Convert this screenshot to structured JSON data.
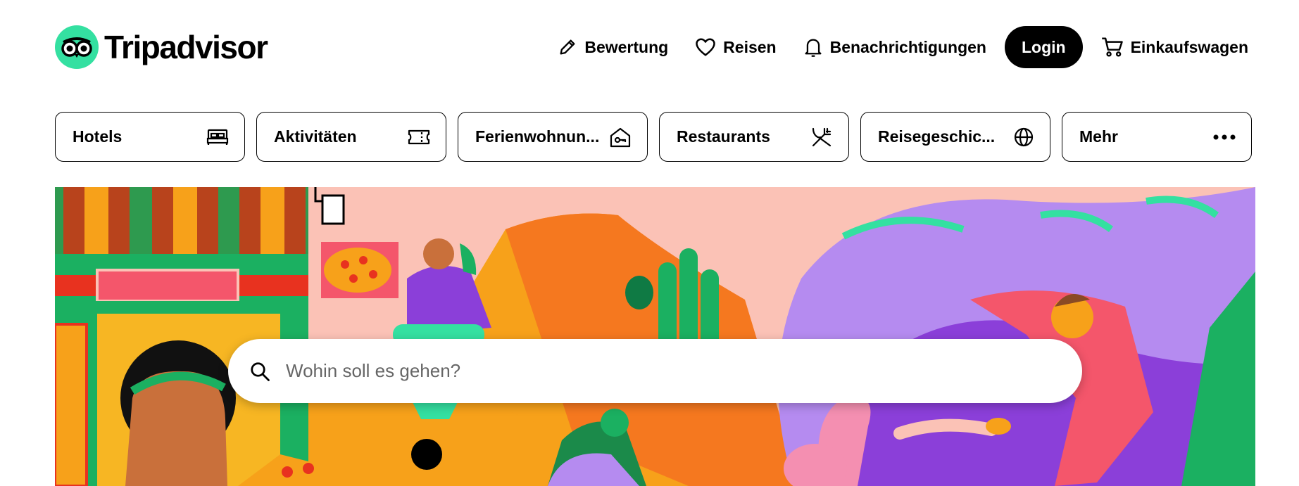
{
  "brand": {
    "name": "Tripadvisor",
    "accent": "#34e0a1"
  },
  "nav": {
    "review": "Bewertung",
    "trips": "Reisen",
    "alerts": "Benachrichtigungen",
    "login": "Login",
    "cart": "Einkaufswagen"
  },
  "categories": [
    {
      "label": "Hotels",
      "icon": "bed-icon"
    },
    {
      "label": "Aktivitäten",
      "icon": "ticket-icon"
    },
    {
      "label": "Ferienwohnun...",
      "icon": "house-key-icon"
    },
    {
      "label": "Restaurants",
      "icon": "fork-knife-icon"
    },
    {
      "label": "Reisegeschic...",
      "icon": "globe-icon"
    },
    {
      "label": "Mehr",
      "icon": "more-dots-icon"
    }
  ],
  "search": {
    "placeholder": "Wohin soll es gehen?"
  }
}
